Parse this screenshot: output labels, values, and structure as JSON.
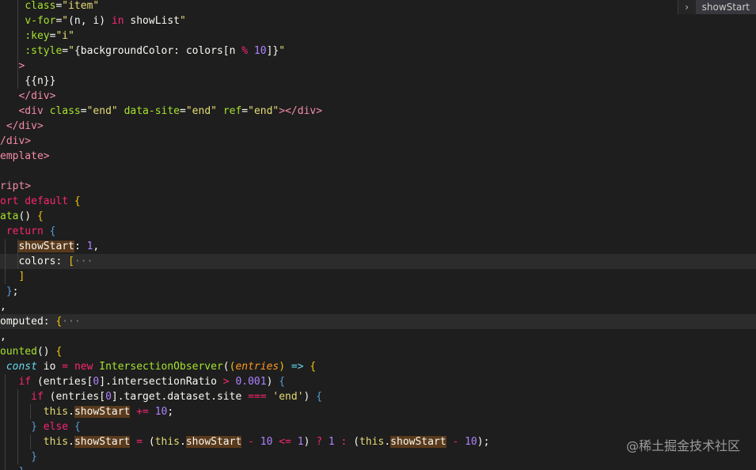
{
  "breadcrumb": {
    "chevron": "›",
    "symbol": "showStart"
  },
  "watermark": "@稀土掘金技术社区",
  "editor": {
    "lines": [
      [
        {
          "t": "    ",
          "c": "c-id"
        },
        {
          "t": "class",
          "c": "c-attr"
        },
        {
          "t": "=",
          "c": "c-punc"
        },
        {
          "t": "\"item\"",
          "c": "c-str"
        }
      ],
      [
        {
          "t": "    ",
          "c": "c-id"
        },
        {
          "t": "v-for",
          "c": "c-attr"
        },
        {
          "t": "=",
          "c": "c-punc"
        },
        {
          "t": "\"",
          "c": "c-str"
        },
        {
          "t": "(n, i) ",
          "c": "c-id"
        },
        {
          "t": "in",
          "c": "c-kw"
        },
        {
          "t": " showList",
          "c": "c-id"
        },
        {
          "t": "\"",
          "c": "c-str"
        }
      ],
      [
        {
          "t": "    ",
          "c": "c-id"
        },
        {
          "t": ":key",
          "c": "c-attr"
        },
        {
          "t": "=",
          "c": "c-punc"
        },
        {
          "t": "\"i\"",
          "c": "c-str"
        }
      ],
      [
        {
          "t": "    ",
          "c": "c-id"
        },
        {
          "t": ":style",
          "c": "c-attr"
        },
        {
          "t": "=",
          "c": "c-punc"
        },
        {
          "t": "\"",
          "c": "c-str"
        },
        {
          "t": "{backgroundColor: colors[n ",
          "c": "c-id"
        },
        {
          "t": "%",
          "c": "c-op"
        },
        {
          "t": " ",
          "c": "c-id"
        },
        {
          "t": "10",
          "c": "c-num"
        },
        {
          "t": "]}",
          "c": "c-id"
        },
        {
          "t": "\"",
          "c": "c-str"
        }
      ],
      [
        {
          "t": "   ",
          "c": "c-id"
        },
        {
          "t": ">",
          "c": "c-tag"
        }
      ],
      [
        {
          "t": "    {{n}}",
          "c": "c-id"
        }
      ],
      [
        {
          "t": "   ",
          "c": "c-id"
        },
        {
          "t": "</div>",
          "c": "c-tag"
        }
      ],
      [
        {
          "t": "   ",
          "c": "c-id"
        },
        {
          "t": "<div ",
          "c": "c-tag"
        },
        {
          "t": "class",
          "c": "c-attr"
        },
        {
          "t": "=",
          "c": "c-punc"
        },
        {
          "t": "\"end\" ",
          "c": "c-str"
        },
        {
          "t": "data-site",
          "c": "c-attr"
        },
        {
          "t": "=",
          "c": "c-punc"
        },
        {
          "t": "\"end\" ",
          "c": "c-str"
        },
        {
          "t": "ref",
          "c": "c-attr"
        },
        {
          "t": "=",
          "c": "c-punc"
        },
        {
          "t": "\"end\"",
          "c": "c-str"
        },
        {
          "t": "></div>",
          "c": "c-tag"
        }
      ],
      [
        {
          "t": " ",
          "c": "c-id"
        },
        {
          "t": "</div>",
          "c": "c-tag"
        }
      ],
      [
        {
          "t": "/div>",
          "c": "c-tag"
        }
      ],
      [
        {
          "t": "emplate>",
          "c": "c-tag"
        }
      ],
      [],
      [
        {
          "t": "ript>",
          "c": "c-tag"
        }
      ],
      [
        {
          "t": "ort default ",
          "c": "c-kw"
        },
        {
          "t": "{",
          "c": "c-brace"
        }
      ],
      [
        {
          "t": "ata",
          "c": "c-fn"
        },
        {
          "t": "() ",
          "c": "c-id"
        },
        {
          "t": "{",
          "c": "c-brace"
        }
      ],
      [
        {
          "t": " return ",
          "c": "c-kw"
        },
        {
          "t": "{",
          "c": "c-brace2"
        }
      ],
      [
        {
          "t": "   ",
          "c": "c-id"
        },
        {
          "t": "showStart",
          "c": "c-prop hl"
        },
        {
          "t": ": ",
          "c": "c-punc"
        },
        {
          "t": "1",
          "c": "c-num"
        },
        {
          "t": ",",
          "c": "c-punc"
        }
      ],
      [
        {
          "t": "   colors: ",
          "c": "c-prop"
        },
        {
          "t": "[",
          "c": "c-brace"
        },
        {
          "t": "···",
          "c": "c-fold"
        }
      ],
      [
        {
          "t": "   ",
          "c": "c-id"
        },
        {
          "t": "]",
          "c": "c-brace"
        }
      ],
      [
        {
          "t": " ",
          "c": "c-id"
        },
        {
          "t": "}",
          "c": "c-brace2"
        },
        {
          "t": ";",
          "c": "c-punc"
        }
      ],
      [
        {
          "t": ",",
          "c": "c-punc"
        }
      ],
      [
        {
          "t": "omputed: ",
          "c": "c-prop"
        },
        {
          "t": "{",
          "c": "c-brace"
        },
        {
          "t": "···",
          "c": "c-fold"
        }
      ],
      [
        {
          "t": ",",
          "c": "c-punc"
        }
      ],
      [
        {
          "t": "ounted",
          "c": "c-fn"
        },
        {
          "t": "() ",
          "c": "c-id"
        },
        {
          "t": "{",
          "c": "c-brace"
        }
      ],
      [
        {
          "t": " ",
          "c": "c-id"
        },
        {
          "t": "const",
          "c": "c-const"
        },
        {
          "t": " io ",
          "c": "c-id"
        },
        {
          "t": "=",
          "c": "c-op"
        },
        {
          "t": " ",
          "c": "c-id"
        },
        {
          "t": "new",
          "c": "c-kw"
        },
        {
          "t": " IntersectionObserver",
          "c": "c-fn"
        },
        {
          "t": "(",
          "c": "c-id"
        },
        {
          "t": "(",
          "c": "c-brace"
        },
        {
          "t": "entries",
          "c": "c-param"
        },
        {
          "t": ")",
          "c": "c-brace"
        },
        {
          "t": " ",
          "c": "c-id"
        },
        {
          "t": "=>",
          "c": "c-const"
        },
        {
          "t": " ",
          "c": "c-id"
        },
        {
          "t": "{",
          "c": "c-brace"
        }
      ],
      [
        {
          "t": "   ",
          "c": "c-id"
        },
        {
          "t": "if",
          "c": "c-kw"
        },
        {
          "t": " (entries[",
          "c": "c-id"
        },
        {
          "t": "0",
          "c": "c-num"
        },
        {
          "t": "].intersectionRatio ",
          "c": "c-id"
        },
        {
          "t": ">",
          "c": "c-op"
        },
        {
          "t": " ",
          "c": "c-id"
        },
        {
          "t": "0.001",
          "c": "c-num"
        },
        {
          "t": ") ",
          "c": "c-id"
        },
        {
          "t": "{",
          "c": "c-brace2"
        }
      ],
      [
        {
          "t": "     ",
          "c": "c-id"
        },
        {
          "t": "if",
          "c": "c-kw"
        },
        {
          "t": " (entries[",
          "c": "c-id"
        },
        {
          "t": "0",
          "c": "c-num"
        },
        {
          "t": "].target.dataset.site ",
          "c": "c-id"
        },
        {
          "t": "===",
          "c": "c-op"
        },
        {
          "t": " ",
          "c": "c-id"
        },
        {
          "t": "'end'",
          "c": "c-str"
        },
        {
          "t": ") ",
          "c": "c-id"
        },
        {
          "t": "{",
          "c": "c-brace2"
        }
      ],
      [
        {
          "t": "       ",
          "c": "c-id"
        },
        {
          "t": "this",
          "c": "c-str"
        },
        {
          "t": ".",
          "c": "c-id"
        },
        {
          "t": "showStart",
          "c": "c-id hl"
        },
        {
          "t": " ",
          "c": "c-id"
        },
        {
          "t": "+=",
          "c": "c-op"
        },
        {
          "t": " ",
          "c": "c-id"
        },
        {
          "t": "10",
          "c": "c-num"
        },
        {
          "t": ";",
          "c": "c-punc"
        }
      ],
      [
        {
          "t": "     ",
          "c": "c-id"
        },
        {
          "t": "}",
          "c": "c-brace2"
        },
        {
          "t": " ",
          "c": "c-id"
        },
        {
          "t": "else",
          "c": "c-kw"
        },
        {
          "t": " ",
          "c": "c-id"
        },
        {
          "t": "{",
          "c": "c-brace2"
        }
      ],
      [
        {
          "t": "       ",
          "c": "c-id"
        },
        {
          "t": "this",
          "c": "c-str"
        },
        {
          "t": ".",
          "c": "c-id"
        },
        {
          "t": "showStart",
          "c": "c-id hl"
        },
        {
          "t": " ",
          "c": "c-id"
        },
        {
          "t": "=",
          "c": "c-op"
        },
        {
          "t": " (",
          "c": "c-id"
        },
        {
          "t": "this",
          "c": "c-str"
        },
        {
          "t": ".",
          "c": "c-id"
        },
        {
          "t": "showStart",
          "c": "c-id hl"
        },
        {
          "t": " ",
          "c": "c-id"
        },
        {
          "t": "-",
          "c": "c-op"
        },
        {
          "t": " ",
          "c": "c-id"
        },
        {
          "t": "10",
          "c": "c-num"
        },
        {
          "t": " ",
          "c": "c-id"
        },
        {
          "t": "<=",
          "c": "c-op"
        },
        {
          "t": " ",
          "c": "c-id"
        },
        {
          "t": "1",
          "c": "c-num"
        },
        {
          "t": ") ",
          "c": "c-id"
        },
        {
          "t": "?",
          "c": "c-op"
        },
        {
          "t": " ",
          "c": "c-id"
        },
        {
          "t": "1",
          "c": "c-num"
        },
        {
          "t": " ",
          "c": "c-id"
        },
        {
          "t": ":",
          "c": "c-op"
        },
        {
          "t": " (",
          "c": "c-id"
        },
        {
          "t": "this",
          "c": "c-str"
        },
        {
          "t": ".",
          "c": "c-id"
        },
        {
          "t": "showStart",
          "c": "c-id hl"
        },
        {
          "t": " ",
          "c": "c-id"
        },
        {
          "t": "-",
          "c": "c-op"
        },
        {
          "t": " ",
          "c": "c-id"
        },
        {
          "t": "10",
          "c": "c-num"
        },
        {
          "t": ");",
          "c": "c-id"
        }
      ],
      [
        {
          "t": "     ",
          "c": "c-id"
        },
        {
          "t": "}",
          "c": "c-brace2"
        }
      ],
      [
        {
          "t": "   ",
          "c": "c-id"
        },
        {
          "t": "}",
          "c": "c-brace2"
        }
      ]
    ]
  }
}
